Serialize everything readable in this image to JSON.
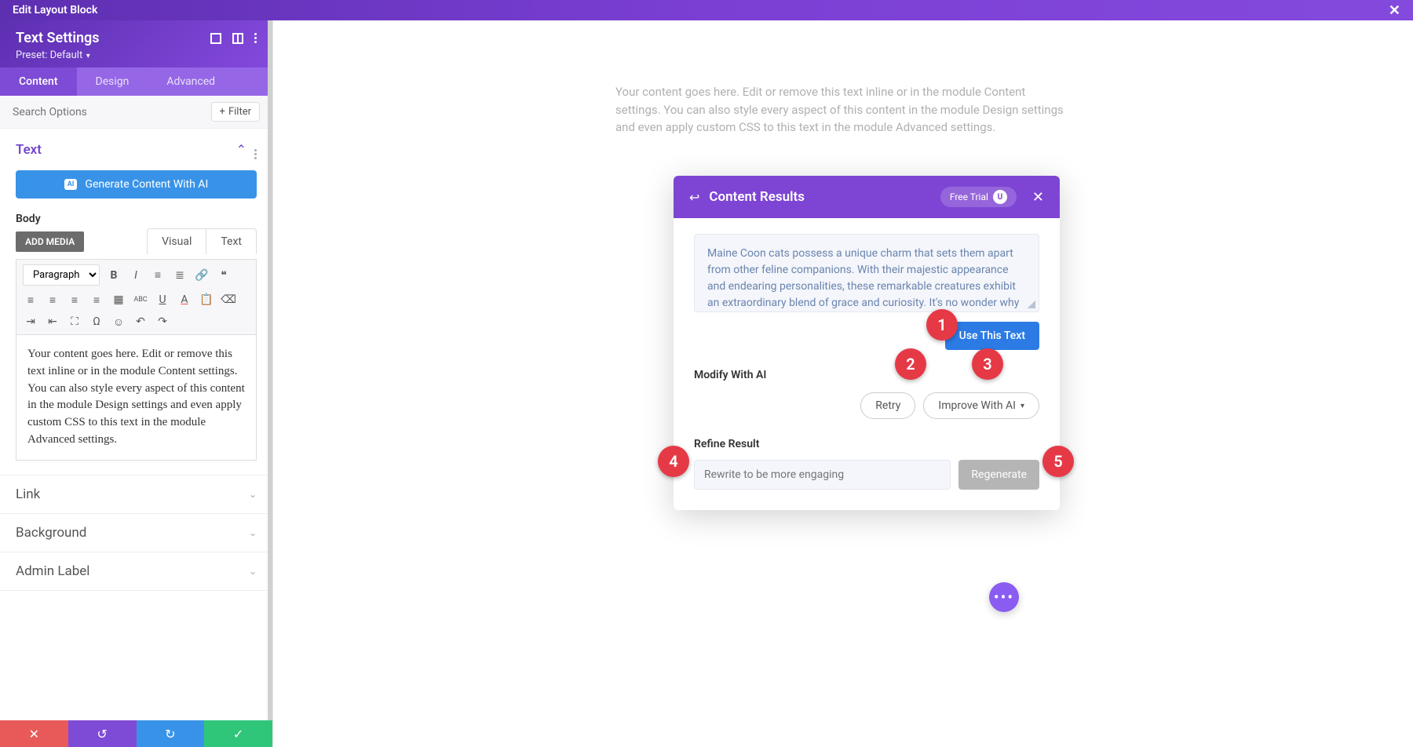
{
  "header": {
    "title": "Edit Layout Block"
  },
  "sidebar": {
    "title": "Text Settings",
    "preset": "Preset: Default",
    "tabs": [
      "Content",
      "Design",
      "Advanced"
    ],
    "active_tab": 0,
    "search_placeholder": "Search Options",
    "filter_label": "Filter",
    "sections": {
      "text": {
        "title": "Text",
        "generate_label": "Generate Content With AI",
        "body_label": "Body",
        "add_media": "ADD MEDIA",
        "editor_tabs": [
          "Visual",
          "Text"
        ],
        "paragraph_label": "Paragraph",
        "content": "Your content goes here. Edit or remove this text inline or in the module Content settings. You can also style every aspect of this content in the module Design settings and even apply custom CSS to this text in the module Advanced settings."
      },
      "link": {
        "title": "Link"
      },
      "background": {
        "title": "Background"
      },
      "admin_label": {
        "title": "Admin Label"
      }
    }
  },
  "main": {
    "placeholder": "Your content goes here. Edit or remove this text inline or in the module Content settings. You can also style every aspect of this content in the module Design settings and even apply custom CSS to this text in the module Advanced settings."
  },
  "modal": {
    "title": "Content Results",
    "free_trial": "Free Trial",
    "trial_badge": "U",
    "result_text": "Maine Coon cats possess a unique charm that sets them apart from other feline companions. With their majestic appearance and endearing personalities, these remarkable creatures exhibit an extraordinary blend of grace and curiosity. It's no wonder why many describe them as having dog-like qualities. Maine Coons are known for their affectionate nature, often greeting their owners at the door and following them around the house",
    "use_text": "Use This Text",
    "modify_label": "Modify With AI",
    "retry": "Retry",
    "improve": "Improve With AI",
    "refine_label": "Refine Result",
    "refine_placeholder": "Rewrite to be more engaging",
    "regenerate": "Regenerate"
  },
  "markers": {
    "1": "1",
    "2": "2",
    "3": "3",
    "4": "4",
    "5": "5"
  }
}
